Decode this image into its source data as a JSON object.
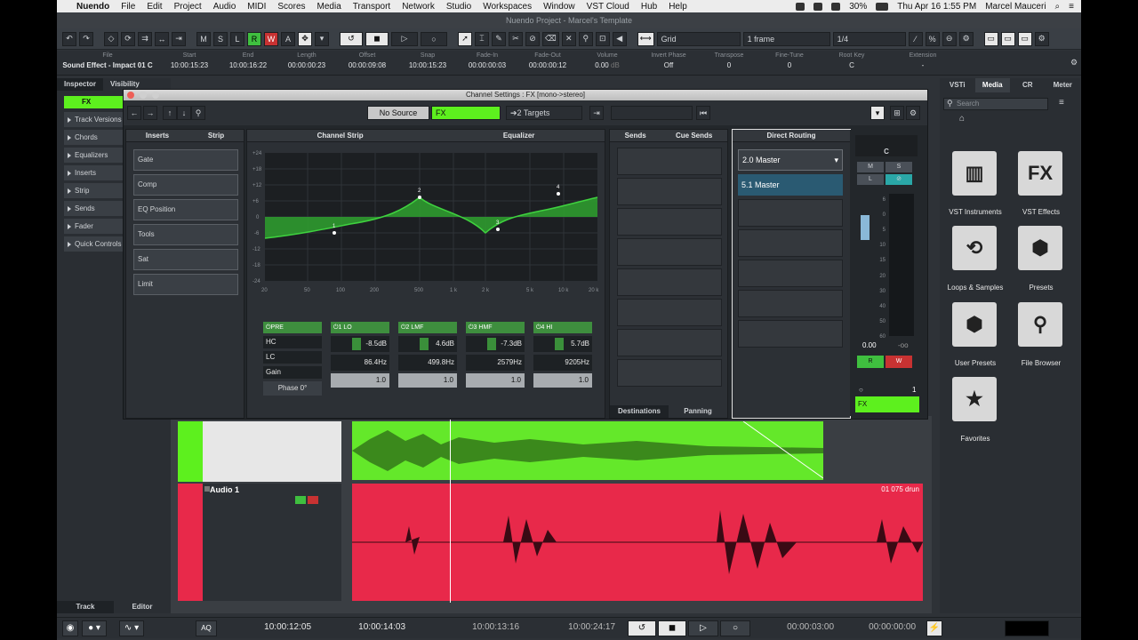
{
  "menubar": {
    "app": "Nuendo",
    "items": [
      "File",
      "Edit",
      "Project",
      "Audio",
      "MIDI",
      "Scores",
      "Media",
      "Transport",
      "Network",
      "Studio",
      "Workspaces",
      "Window",
      "VST Cloud",
      "Hub",
      "Help"
    ],
    "battery": "30%",
    "datetime": "Thu Apr 16  1:55 PM",
    "user": "Marcel Mauceri"
  },
  "window_title": "Nuendo Project - Marcel's Template",
  "toolbar": {
    "m": "M",
    "s": "S",
    "l": "L",
    "r": "R",
    "w": "W",
    "a": "A",
    "snap_type": "Grid",
    "grid_value": "1 frame",
    "quantize": "1/4"
  },
  "infoline": {
    "file_label": "File",
    "file_value": "Sound Effect - Impact 01 C",
    "cells": [
      {
        "label": "Start",
        "value": "10:00:15:23"
      },
      {
        "label": "End",
        "value": "10:00:16:22"
      },
      {
        "label": "Length",
        "value": "00:00:00:23"
      },
      {
        "label": "Offset",
        "value": "00:00:09:08"
      },
      {
        "label": "Snap",
        "value": "10:00:15:23"
      },
      {
        "label": "Fade-In",
        "value": "00:00:00:03"
      },
      {
        "label": "Fade-Out",
        "value": "00:00:00:12"
      },
      {
        "label": "Volume",
        "value": "0.00"
      },
      {
        "label": "Invert Phase",
        "value": "Off"
      },
      {
        "label": "Transpose",
        "value": "0"
      },
      {
        "label": "Fine-Tune",
        "value": "0"
      },
      {
        "label": "Root Key",
        "value": "C"
      },
      {
        "label": "Extension",
        "value": "-"
      }
    ],
    "volume_unit": "dB"
  },
  "inspector": {
    "tab_inspector": "Inspector",
    "tab_visibility": "Visibility",
    "track_name": "FX",
    "sections": [
      "Track Versions",
      "Chords",
      "Equalizers",
      "Inserts",
      "Strip",
      "Sends",
      "Fader",
      "Quick Controls"
    ],
    "bottom_track": "Track",
    "bottom_editor": "Editor"
  },
  "channel_window": {
    "title": "Channel Settings : FX [mono->stereo]",
    "source": "No Source",
    "channel_name": "FX",
    "targets": "2 Targets",
    "tab_inserts": "Inserts",
    "tab_strip": "Strip",
    "strip_modules": [
      "Gate",
      "Comp",
      "EQ Position",
      "Tools",
      "Sat",
      "Limit"
    ],
    "channel_strip_label": "Channel Strip",
    "equalizer_label": "Equalizer",
    "eq_y_ticks": [
      "+24",
      "+18",
      "+12",
      "+6",
      "0",
      "-6",
      "-12",
      "-18",
      "-24"
    ],
    "eq_x_ticks": [
      "20",
      "50",
      "100",
      "200",
      "500",
      "1 k",
      "2 k",
      "5 k",
      "10 k",
      "20 k"
    ],
    "eq_points": [
      "1",
      "2",
      "3",
      "4"
    ],
    "pre": {
      "label": "PRE",
      "hc": "HC",
      "lc": "LC",
      "gain": "Gain",
      "phase": "Phase 0°"
    },
    "bands": [
      {
        "name": "1 LO",
        "gain": "-8.5dB",
        "freq": "86.4Hz",
        "q": "1.0"
      },
      {
        "name": "2 LMF",
        "gain": "4.6dB",
        "freq": "499.8Hz",
        "q": "1.0"
      },
      {
        "name": "3 HMF",
        "gain": "-7.3dB",
        "freq": "2579Hz",
        "q": "1.0"
      },
      {
        "name": "4 HI",
        "gain": "5.7dB",
        "freq": "9205Hz",
        "q": "1.0"
      }
    ],
    "sends_tab": "Sends",
    "cue_sends_tab": "Cue Sends",
    "destinations_tab": "Destinations",
    "panning_tab": "Panning",
    "direct_routing_label": "Direct Routing",
    "routing_selected": "2.0 Master",
    "routing_items": [
      "5.1 Master"
    ],
    "fader": {
      "pan": "C",
      "scale": [
        "6",
        "0",
        "5",
        "10",
        "15",
        "20",
        "30",
        "40",
        "50",
        "60"
      ],
      "volume": "0.00",
      "peak": "-oo",
      "m": "M",
      "s": "S",
      "l": "L",
      "r": "R",
      "w": "W",
      "index": "1",
      "channel_name": "FX"
    }
  },
  "tracks": {
    "audio1_name": "Audio 1",
    "clip_label": "01 075 drun"
  },
  "rightzone": {
    "tabs": [
      "VSTi",
      "Media",
      "CR",
      "Meter"
    ],
    "search_placeholder": "Search",
    "tiles": [
      {
        "label": "VST Instruments",
        "icon": "piano-icon"
      },
      {
        "label": "VST Effects",
        "icon": "fx-icon"
      },
      {
        "label": "Loops & Samples",
        "icon": "loop-icon"
      },
      {
        "label": "Presets",
        "icon": "presets-icon"
      },
      {
        "label": "User Presets",
        "icon": "user-presets-icon"
      },
      {
        "label": "File Browser",
        "icon": "file-browser-icon"
      },
      {
        "label": "Favorites",
        "icon": "star-icon"
      }
    ],
    "fx_glyph": "FX"
  },
  "transport": {
    "aq": "AQ",
    "left_locator": "10:00:12:05",
    "right_locator": "10:00:14:03",
    "punch_in": "10:00:13:16",
    "punch_out": "10:00:24:17",
    "pre_roll": "00:00:03:00",
    "post_roll": "00:00:00:00"
  },
  "colors": {
    "fx_green": "#5df01e",
    "audio_red": "#e8294a",
    "eq_green": "#2f9a2f"
  }
}
